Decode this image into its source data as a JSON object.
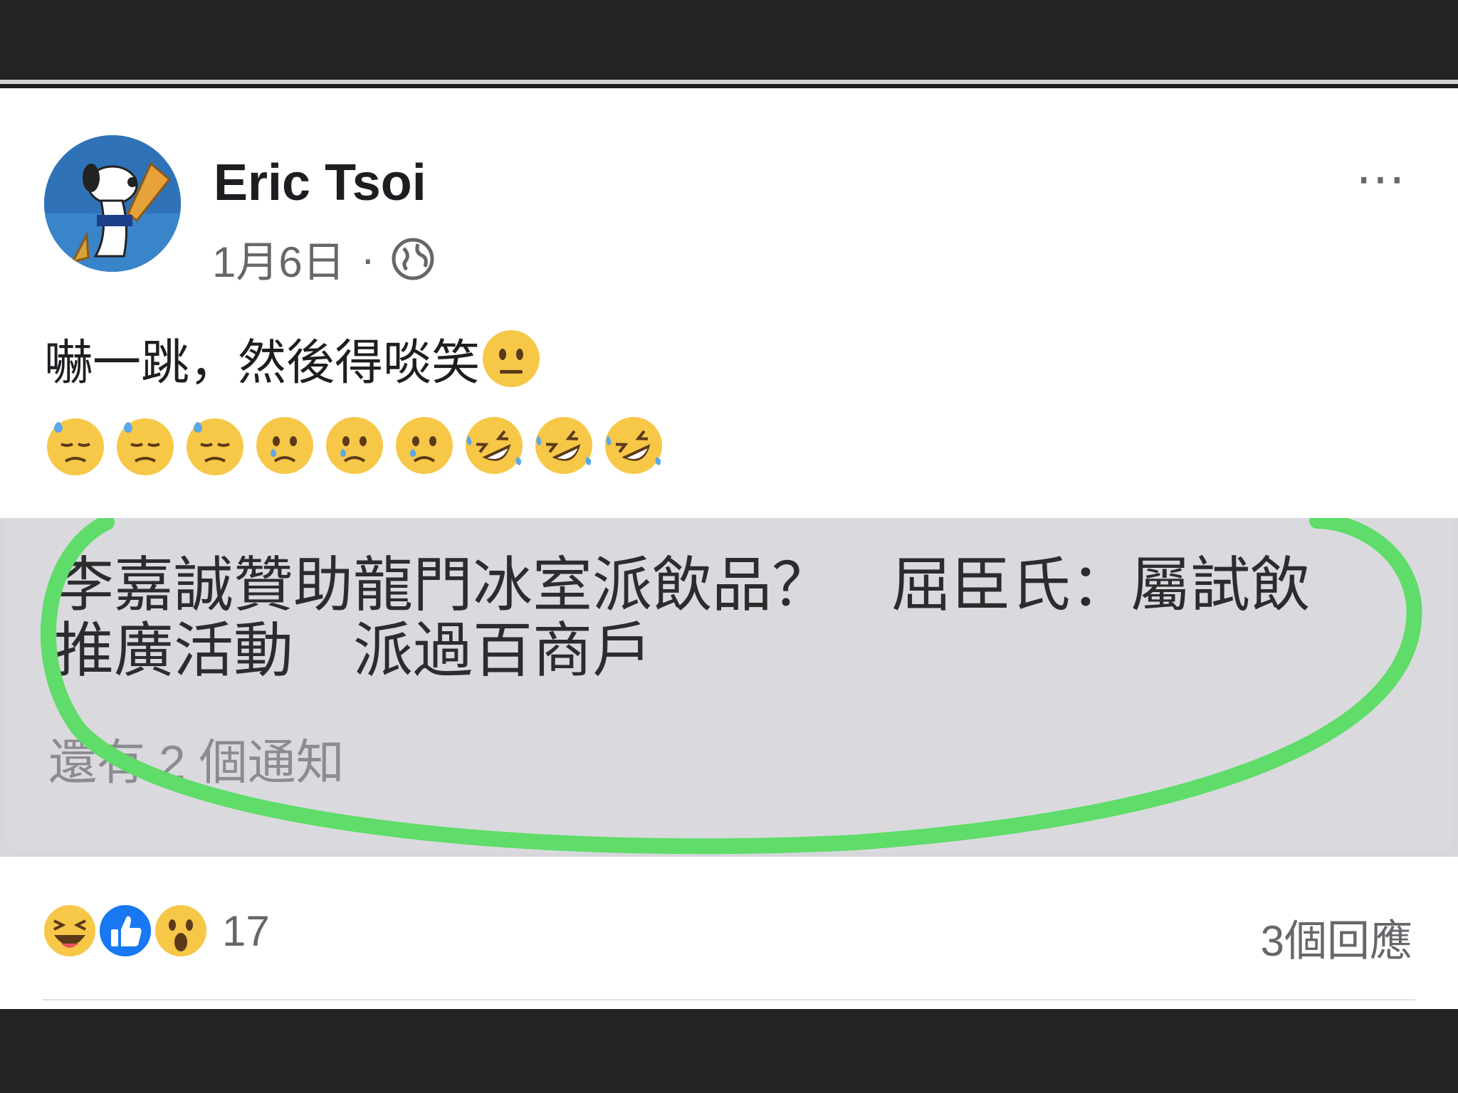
{
  "post": {
    "author": "Eric Tsoi",
    "date": "1月6日",
    "separator": "·",
    "privacy_icon": "globe-icon",
    "text": "嚇一跳，然後得啖笑",
    "text_emoji": "neutral-face-emoji",
    "emoji_row": [
      "downcast-face-with-sweat",
      "downcast-face-with-sweat",
      "downcast-face-with-sweat",
      "crying-face",
      "crying-face",
      "crying-face",
      "rolling-on-floor-laughing",
      "rolling-on-floor-laughing",
      "rolling-on-floor-laughing"
    ],
    "more_label": "⋯"
  },
  "screenshot": {
    "headline_line1": "李嘉誠贊助龍門冰室派飲品？　屈臣氏：屬試飲",
    "headline_line2": "推廣活動　派過百商戶",
    "more_notifications": "還有 2 個通知",
    "highlight_color": "#5fdc6a"
  },
  "footer": {
    "reaction_icons": [
      "laugh-reaction-icon",
      "like-reaction-icon",
      "wow-reaction-icon"
    ],
    "reaction_count": "17",
    "comment_count": "3個回應"
  },
  "colors": {
    "background_bar": "#232325",
    "card": "#ffffff",
    "text": "#1c1e21",
    "secondary_text": "#65676b",
    "like_blue": "#1877f2"
  }
}
